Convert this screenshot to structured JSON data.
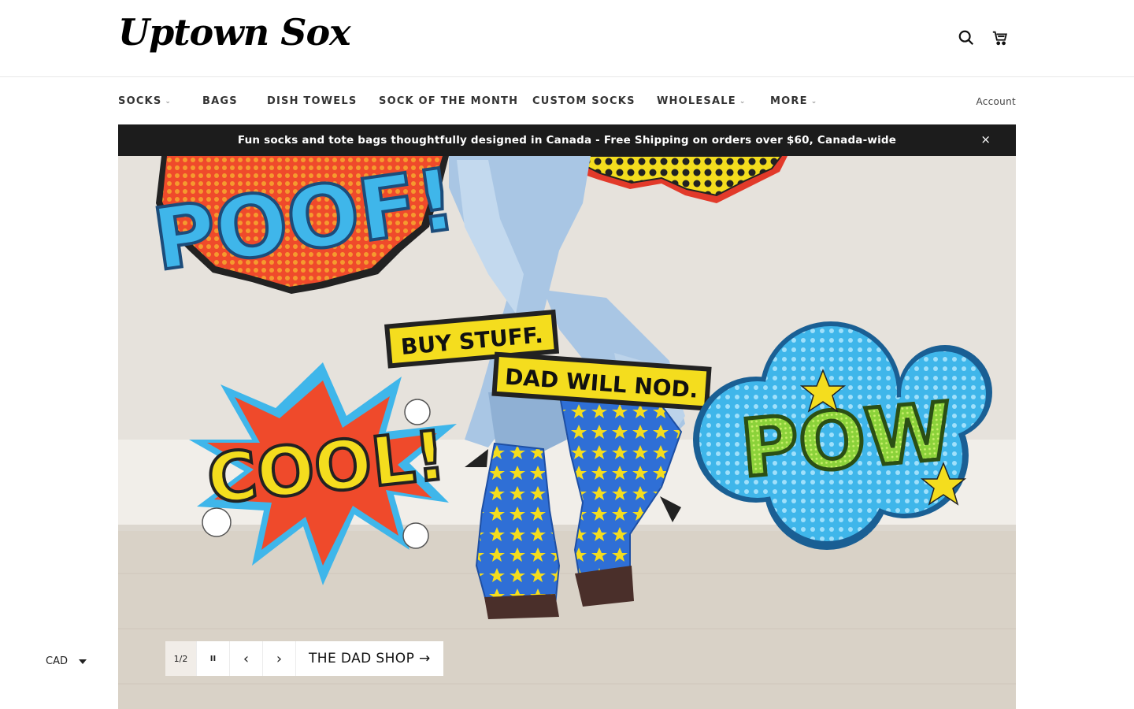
{
  "brand": {
    "logo_text": "Uptown Sox"
  },
  "header": {
    "icons": {
      "search": "search-icon",
      "cart": "cart-icon"
    }
  },
  "nav": {
    "items": [
      {
        "label": "SOCKS",
        "has_dropdown": true
      },
      {
        "label": "BAGS",
        "has_dropdown": false
      },
      {
        "label": "DISH TOWELS",
        "has_dropdown": false
      },
      {
        "label": "SOCK OF THE MONTH",
        "has_dropdown": false
      },
      {
        "label": "CUSTOM SOCKS",
        "has_dropdown": false
      },
      {
        "label": "WHOLESALE",
        "has_dropdown": true
      },
      {
        "label": "MORE",
        "has_dropdown": true
      }
    ],
    "account_label": "Account"
  },
  "announcement": {
    "text": "Fun socks and tote bags thoughtfully designed in Canada - Free Shipping on orders over $60, Canada-wide",
    "close_label": "×"
  },
  "hero": {
    "comic_words": {
      "poof": "POOF!",
      "cool": "COOL!",
      "pow": "POW",
      "caption_line_1": "BUY STUFF.",
      "caption_line_2": "DAD WILL NOD."
    },
    "slideshow": {
      "counter": "1/2",
      "pause_label": "II",
      "prev_label": "‹",
      "next_label": "›",
      "cta_label": "THE DAD SHOP →"
    }
  },
  "footer_widget": {
    "currency": "CAD"
  },
  "colors": {
    "announcement_bg": "#1c1c1c",
    "hero_wall": "#e6e2dc",
    "sock_blue": "#2f6fd6",
    "comic_yellow": "#f4dd1e",
    "comic_red": "#ef4a2b",
    "comic_sky": "#3fb6ea",
    "comic_green": "#8bd23a"
  }
}
